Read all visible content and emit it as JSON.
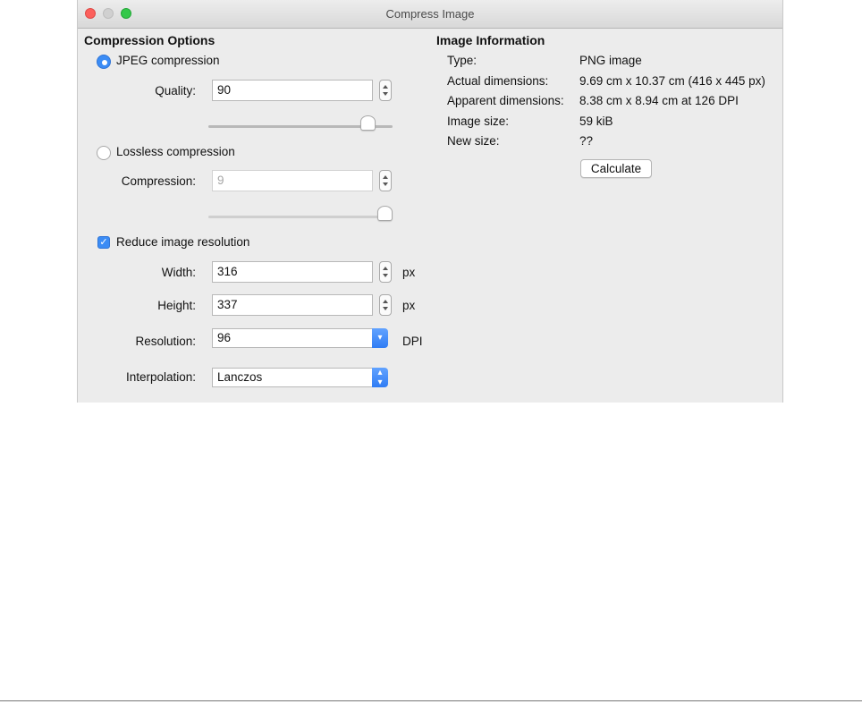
{
  "window": {
    "title": "Compress Image"
  },
  "compression": {
    "heading": "Compression Options",
    "jpeg_label": "JPEG compression",
    "quality_label": "Quality:",
    "quality_value": "90",
    "quality_level": 90,
    "lossless_label": "Lossless compression",
    "compression_label": "Compression:",
    "compression_value": "9",
    "compression_level": 9,
    "reduce_label": "Reduce image resolution",
    "width_label": "Width:",
    "width_value": "316",
    "width_unit": "px",
    "height_label": "Height:",
    "height_value": "337",
    "height_unit": "px",
    "resolution_label": "Resolution:",
    "resolution_value": "96",
    "resolution_unit": "DPI",
    "interpolation_label": "Interpolation:",
    "interpolation_value": "Lanczos"
  },
  "info": {
    "heading": "Image Information",
    "rows": [
      {
        "label": "Type:",
        "value": "PNG image"
      },
      {
        "label": "Actual dimensions:",
        "value": "9.69 cm x 10.37 cm (416 x 445 px)"
      },
      {
        "label": "Apparent dimensions:",
        "value": "8.38 cm x 8.94 cm at 126 DPI"
      },
      {
        "label": "Image size:",
        "value": "59 kiB"
      },
      {
        "label": "New size:",
        "value": "??"
      }
    ],
    "calculate_label": "Calculate"
  },
  "colors": {
    "accent": "#3b8cf5",
    "window_bg": "#ececec"
  }
}
